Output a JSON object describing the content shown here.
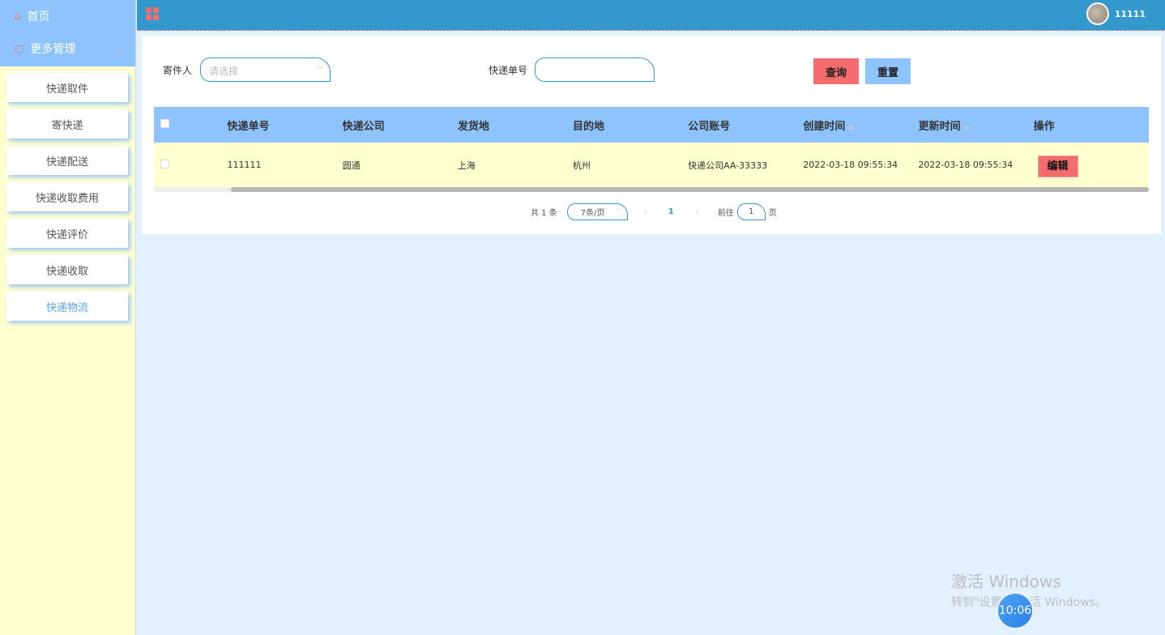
{
  "sidebar": {
    "home": "首页",
    "group": "更多管理",
    "items": [
      "快递取件",
      "寄快递",
      "快递配送",
      "快递收取费用",
      "快递评价",
      "快递收取",
      "快递物流"
    ]
  },
  "header": {
    "username": "11111"
  },
  "search": {
    "sender_label": "寄件人",
    "sender_placeholder": "请选择",
    "tracking_label": "快递单号",
    "tracking_value": "",
    "query": "查询",
    "reset": "重置"
  },
  "table": {
    "headers": [
      "快递单号",
      "快递公司",
      "发货地",
      "目的地",
      "公司账号",
      "创建时间",
      "更新时间",
      "操作"
    ],
    "rows": [
      {
        "no": "111111",
        "company": "圆通",
        "from": "上海",
        "to": "杭州",
        "account": "快递公司AA-33333",
        "created": "2022-03-18 09:55:34",
        "updated": "2022-03-18 09:55:34",
        "edit": "编辑"
      }
    ]
  },
  "pagination": {
    "total": "共 1 条",
    "page_size": "7条/页",
    "current": "1",
    "goto": "前往",
    "goto_value": "1",
    "page_suffix": "页"
  },
  "watermark": {
    "line1": "激活 Windows",
    "line2": "转到\"设置\"以激活 Windows。"
  },
  "clock": "10:06"
}
